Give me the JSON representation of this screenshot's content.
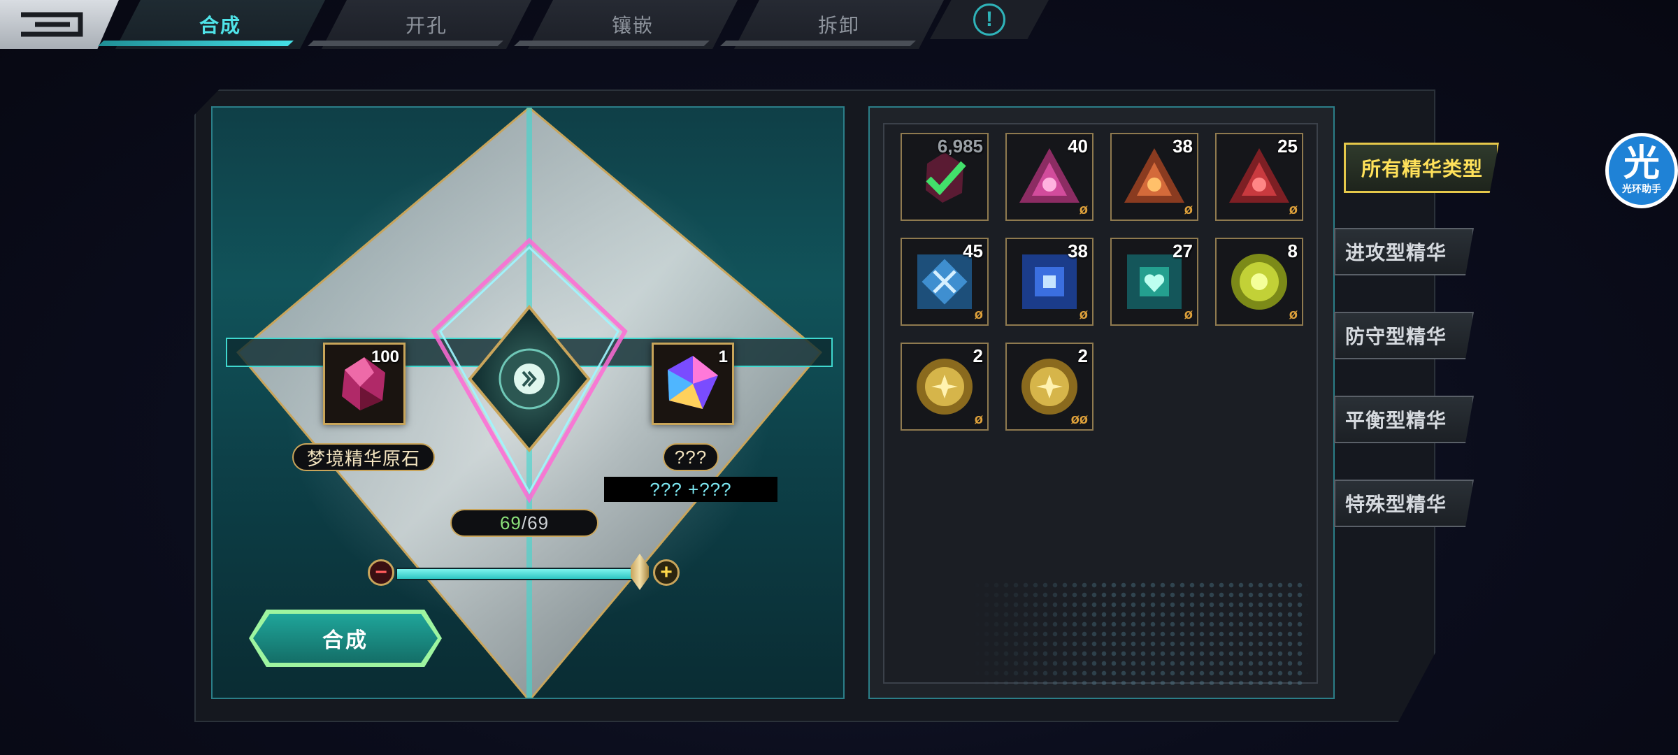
{
  "tabs": [
    {
      "label": "合成",
      "active": true
    },
    {
      "label": "开孔",
      "active": false
    },
    {
      "label": "镶嵌",
      "active": false
    },
    {
      "label": "拆卸",
      "active": false
    }
  ],
  "info_icon": "!",
  "synthesis": {
    "input": {
      "name": "梦境精华原石",
      "count": "100",
      "icon": "pink-crystal-ore-icon"
    },
    "output": {
      "name": "???",
      "count": "1",
      "effect": "??? +???",
      "icon": "prism-cube-icon"
    },
    "progress": {
      "current": "69",
      "separator": "/",
      "max": "69"
    },
    "slider": {
      "fraction": 1.0
    },
    "button_label": "合成"
  },
  "inventory": {
    "items": [
      {
        "qty": "6,985",
        "dim": true,
        "icon": "selected-ore-check-icon",
        "lock": ""
      },
      {
        "qty": "40",
        "icon": "pink-triangle-essence-icon",
        "lock": "ø"
      },
      {
        "qty": "38",
        "icon": "orange-triangle-essence-icon",
        "lock": "ø"
      },
      {
        "qty": "25",
        "icon": "red-triangle-essence-icon",
        "lock": "ø"
      },
      {
        "qty": "45",
        "icon": "blue-square-essence-icon",
        "lock": "ø"
      },
      {
        "qty": "38",
        "icon": "blue-square-essence-2-icon",
        "lock": "ø"
      },
      {
        "qty": "27",
        "icon": "green-heart-square-essence-icon",
        "lock": "ø"
      },
      {
        "qty": "8",
        "icon": "yellow-gear-essence-icon",
        "lock": "ø"
      },
      {
        "qty": "2",
        "icon": "gold-gear-essence-icon",
        "lock": "ø"
      },
      {
        "qty": "2",
        "icon": "gold-gear-essence-2-icon",
        "lock": "øø"
      }
    ]
  },
  "categories": [
    {
      "label": "所有精华类型",
      "active": true
    },
    {
      "label": "进攻型精华",
      "active": false
    },
    {
      "label": "防守型精华",
      "active": false
    },
    {
      "label": "平衡型精华",
      "active": false
    },
    {
      "label": "特殊型精华",
      "active": false
    }
  ],
  "helper_badge": {
    "big": "光",
    "small": "光环助手"
  },
  "colors": {
    "accent": "#45e0e6",
    "gold": "#c9a55b",
    "active_category": "#ffe15a",
    "progress_current": "#8be27a"
  }
}
